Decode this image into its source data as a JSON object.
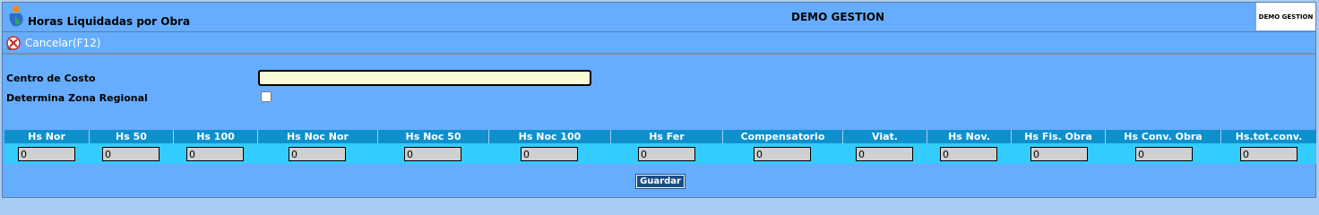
{
  "header": {
    "window_title": "Horas Liquidadas por Obra",
    "company_name": "DEMO GESTION",
    "company_badge": "DEMO GESTION"
  },
  "toolbar": {
    "cancel_label": "Cancelar(F12)"
  },
  "form": {
    "centro_costo_label": "Centro de Costo",
    "centro_costo_value": "",
    "zona_regional_label": "Determina Zona Regional",
    "zona_regional_checked": false
  },
  "grid": {
    "columns": [
      {
        "label": "Hs Nor",
        "value": "0"
      },
      {
        "label": "Hs 50",
        "value": "0"
      },
      {
        "label": "Hs 100",
        "value": "0"
      },
      {
        "label": "Hs Noc Nor",
        "value": "0"
      },
      {
        "label": "Hs Noc 50",
        "value": "0"
      },
      {
        "label": "Hs Noc 100",
        "value": "0"
      },
      {
        "label": "Hs Fer",
        "value": "0"
      },
      {
        "label": "Compensatorio",
        "value": "0"
      },
      {
        "label": "Viat.",
        "value": "0"
      },
      {
        "label": "Hs Nov.",
        "value": "0"
      },
      {
        "label": "Hs Fis. Obra",
        "value": "0"
      },
      {
        "label": "Hs Conv. Obra",
        "value": "0"
      },
      {
        "label": "Hs.tot.conv.",
        "value": "0"
      }
    ]
  },
  "actions": {
    "save_label": "Guardar"
  },
  "icons": {
    "app": "app-logo-icon",
    "cancel": "cancel-icon"
  }
}
